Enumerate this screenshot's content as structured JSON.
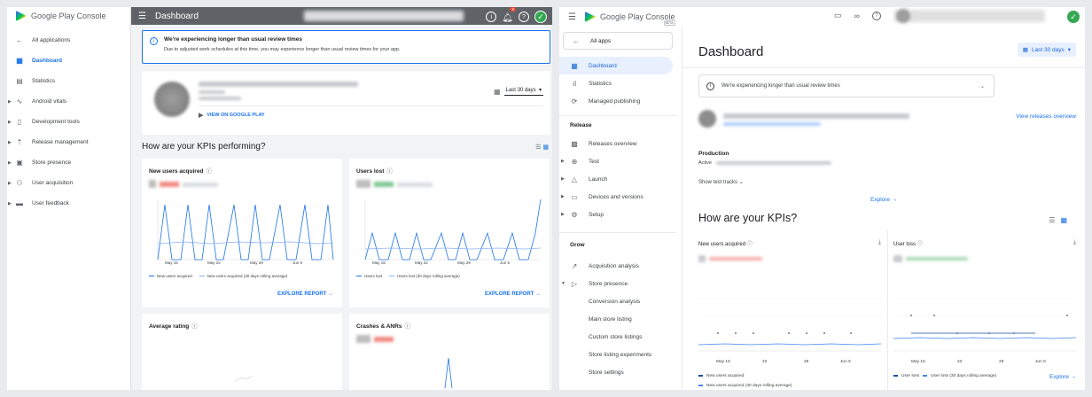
{
  "old_console": {
    "logo_text": "Google Play Console",
    "header_title": "Dashboard",
    "notification_count": "9",
    "nav": [
      {
        "label": "All applications",
        "icon": "arrow-back-icon"
      },
      {
        "label": "Dashboard",
        "icon": "dashboard-icon",
        "active": true
      },
      {
        "label": "Statistics",
        "icon": "statistics-icon"
      },
      {
        "label": "Android vitals",
        "icon": "vitals-icon"
      },
      {
        "label": "Development tools",
        "icon": "dev-tools-icon"
      },
      {
        "label": "Release management",
        "icon": "rocket-icon"
      },
      {
        "label": "Store presence",
        "icon": "store-icon"
      },
      {
        "label": "User acquisition",
        "icon": "people-icon"
      },
      {
        "label": "User feedback",
        "icon": "feedback-icon"
      }
    ],
    "alert": {
      "title": "We're experiencing longer than usual review times",
      "body": "Due to adjusted work schedules at this time, you may experience longer than usual review times for your app."
    },
    "date_range": "Last 30 days",
    "play_link": "VIEW ON GOOGLE PLAY",
    "kpi_section_title": "How are your KPIs performing?",
    "kpis": [
      {
        "title": "New users acquired",
        "explore": "EXPLORE REPORT",
        "legend_daily": "New users acquired",
        "legend_avg": "New users acquired (30 days rolling average)",
        "x_ticks": [
          "May 15",
          "May 22",
          "May 29",
          "Jun 5"
        ]
      },
      {
        "title": "Users lost",
        "explore": "EXPLORE REPORT",
        "legend_daily": "Users lost",
        "legend_avg": "Users lost (30 days rolling average)",
        "x_ticks": [
          "May 15",
          "May 22",
          "May 29",
          "Jun 5"
        ]
      },
      {
        "title": "Average rating"
      },
      {
        "title": "Crashes & ANRs"
      }
    ]
  },
  "new_console": {
    "logo_text": "Google Play Console",
    "beta": "BETA",
    "all_apps": "All apps",
    "nav_top": [
      {
        "label": "Dashboard",
        "icon": "dashboard-icon",
        "active": true
      },
      {
        "label": "Statistics",
        "icon": "statistics-icon"
      },
      {
        "label": "Managed publishing",
        "icon": "managed-publishing-icon"
      }
    ],
    "release_section": "Release",
    "nav_release": [
      {
        "label": "Releases overview",
        "icon": "releases-overview-icon"
      },
      {
        "label": "Test",
        "icon": "test-icon"
      },
      {
        "label": "Launch",
        "icon": "launch-icon"
      },
      {
        "label": "Devices and versions",
        "icon": "devices-icon"
      },
      {
        "label": "Setup",
        "icon": "setup-icon"
      }
    ],
    "grow_section": "Grow",
    "nav_grow": [
      {
        "label": "Acquisition analysis",
        "icon": "acquisition-icon"
      },
      {
        "label": "Store presence",
        "icon": "store-presence-icon"
      }
    ],
    "nav_store_sub": [
      "Conversion analysis",
      "Main store listing",
      "Custom store listings",
      "Store listing experiments",
      "Store settings"
    ],
    "page_title": "Dashboard",
    "date_range": "Last 30 days",
    "alert": "We're experiencing longer than usual review times",
    "view_releases": "View releases overview",
    "production_label": "Production",
    "active_label": "Active",
    "show_test_tracks": "Show test tracks",
    "kpi_title": "How are your KPIs?",
    "kpis": [
      {
        "title": "New users acquired",
        "explore": "Explore",
        "x_ticks": [
          "May 15",
          "22",
          "29",
          "Jun 5"
        ],
        "legend": [
          "New users acquired",
          "New users acquired (30 days rolling average)"
        ]
      },
      {
        "title": "User loss",
        "explore": "Explore",
        "x_ticks": [
          "May 15",
          "22",
          "29",
          "Jun 5"
        ],
        "legend": [
          "User loss",
          "User loss (30 days rolling average)"
        ]
      }
    ]
  },
  "colors": {
    "accent": "#1a73e8",
    "header_bg": "#5f6368",
    "success": "#34a853",
    "line_light": "#8ab4f8"
  }
}
